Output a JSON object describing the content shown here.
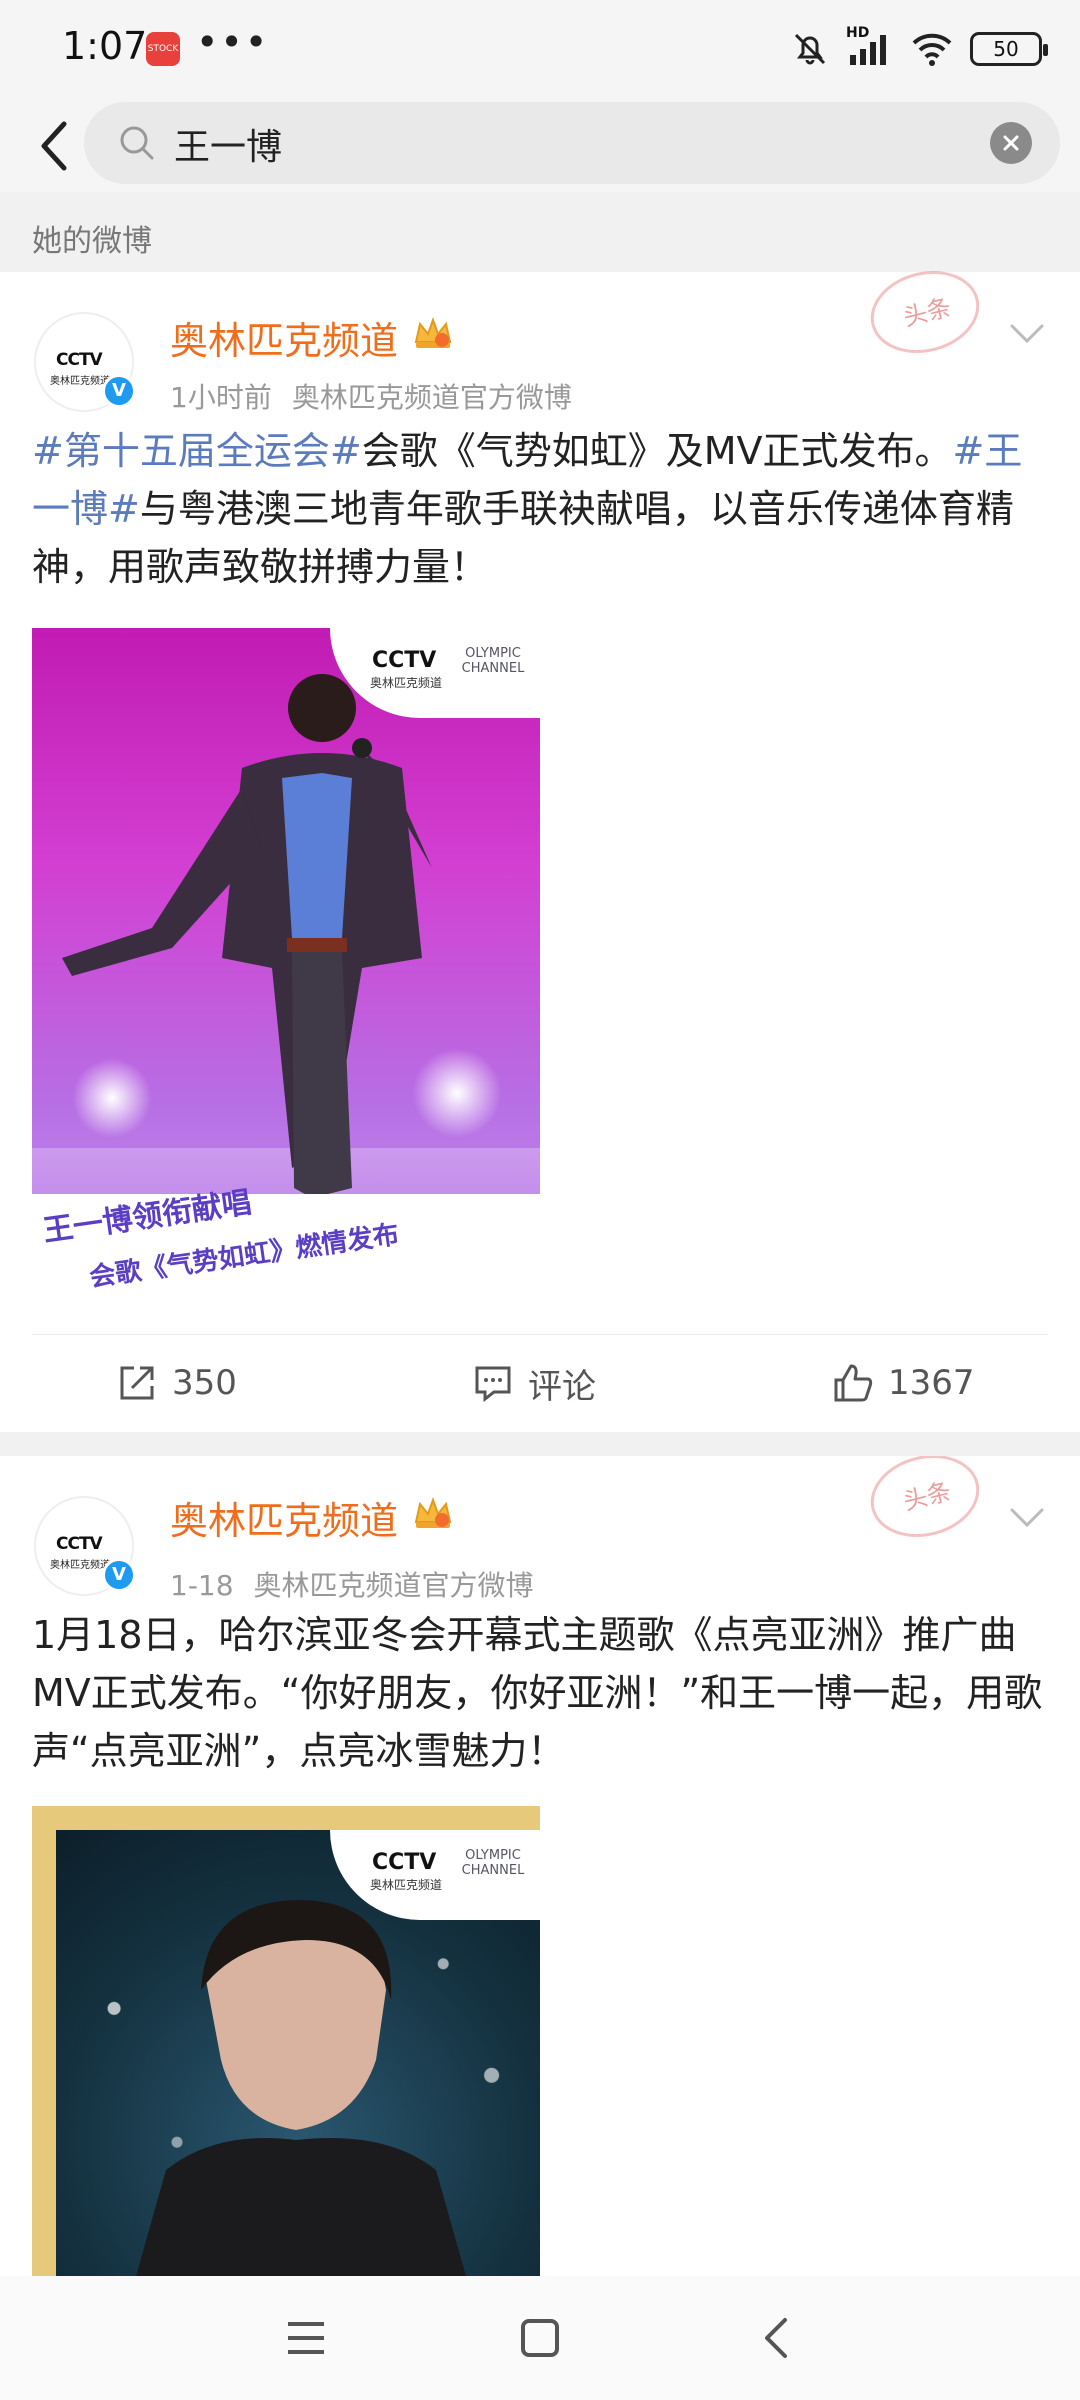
{
  "status_bar": {
    "time": "1:07",
    "app_badge": "STOCK",
    "more": "•••",
    "network_label": "HD",
    "battery": "50"
  },
  "search": {
    "query": "王一博"
  },
  "section": {
    "label": "她的微博"
  },
  "posts": [
    {
      "author": "奥林匹克频道",
      "time": "1小时前",
      "source": "奥林匹克频道官方微博",
      "stamp": "头条",
      "text_parts": {
        "topic1": "#第十五届全运会#",
        "text1": "会歌《气势如虹》及MV正式发布。",
        "topic2": "#王一博#",
        "text2": "与粤港澳三地青年歌手联袂献唱，以音乐传递体育精神，用歌声致敬拼搏力量！"
      },
      "image_caption_line1": "王一博领衔献唱",
      "image_caption_line2": "会歌《气势如虹》燃情发布",
      "logo_cctv": "CCTV",
      "logo_cn": "奥林匹克频道",
      "logo_olympic": "OLYMPIC CHANNEL",
      "repost_count": "350",
      "comment_label": "评论",
      "like_count": "1367"
    },
    {
      "author": "奥林匹克频道",
      "time": "1-18",
      "source": "奥林匹克频道官方微博",
      "stamp": "头条",
      "text": "1月18日，哈尔滨亚冬会开幕式主题歌《点亮亚洲》推广曲MV正式发布。“你好朋友，你好亚洲！”和王一博一起，用歌声“点亮亚洲”，点亮冰雪魅力！",
      "logo_cctv": "CCTV",
      "logo_cn": "奥林匹克频道",
      "logo_olympic": "OLYMPIC CHANNEL"
    }
  ],
  "avatar": {
    "mark": "CCTV",
    "sub": "奥林匹克频道",
    "verified": "V"
  },
  "colors": {
    "author": "#f06d1c",
    "topic": "#5b7bbd",
    "verified": "#1e9bf0"
  }
}
